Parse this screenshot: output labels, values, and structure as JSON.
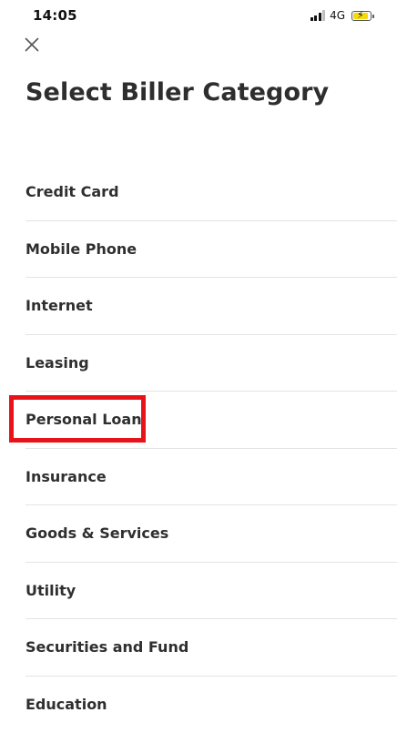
{
  "status_bar": {
    "time": "14:05",
    "network": "4G",
    "signal_icon": "signal-bars-icon",
    "battery_icon": "battery-charging-icon"
  },
  "close_icon": "close-icon",
  "page": {
    "title": "Select Biller Category"
  },
  "categories": [
    {
      "label": "Credit Card"
    },
    {
      "label": "Mobile Phone"
    },
    {
      "label": "Internet"
    },
    {
      "label": "Leasing"
    },
    {
      "label": "Personal Loan",
      "highlighted": true
    },
    {
      "label": "Insurance"
    },
    {
      "label": "Goods & Services"
    },
    {
      "label": "Utility"
    },
    {
      "label": "Securities and Fund"
    },
    {
      "label": "Education"
    }
  ],
  "colors": {
    "highlight": "#e8121a",
    "text": "#2f2f2f",
    "divider": "#e4e4e4",
    "battery": "#f5d90c"
  }
}
